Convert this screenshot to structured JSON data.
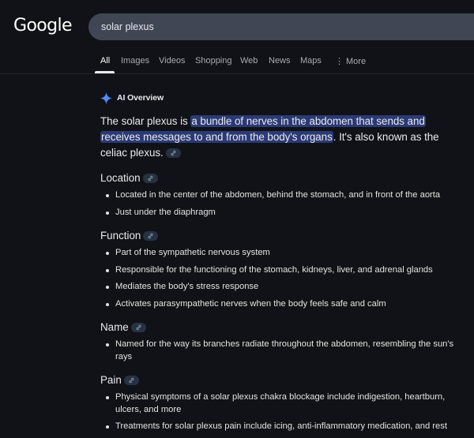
{
  "header": {
    "logo": "Google",
    "search_value": "solar plexus"
  },
  "tabs": [
    {
      "label": "All",
      "active": true
    },
    {
      "label": "Images",
      "active": false
    },
    {
      "label": "Videos",
      "active": false
    },
    {
      "label": "Shopping",
      "active": false
    },
    {
      "label": "Web",
      "active": false
    },
    {
      "label": "News",
      "active": false
    },
    {
      "label": "Maps",
      "active": false
    },
    {
      "label": "More",
      "active": false
    }
  ],
  "ai_overview": {
    "label": "AI Overview",
    "icon": "sparkle-icon",
    "accent_color": "#4c8df6",
    "highlight_color": "#2b3a74",
    "intro_before": "The solar plexus is ",
    "intro_highlight": "a bundle of nerves in the abdomen that sends and receives messages to and from the body's organs",
    "intro_after": ". It's also known as the celiac plexus.",
    "sections": [
      {
        "title": "Location",
        "items": [
          "Located in the center of the abdomen, behind the stomach, and in front of the aorta",
          "Just under the diaphragm"
        ]
      },
      {
        "title": "Function",
        "items": [
          "Part of the sympathetic nervous system",
          "Responsible for the functioning of the stomach, kidneys, liver, and adrenal glands",
          "Mediates the body's stress response",
          "Activates parasympathetic nerves when the body feels safe and calm"
        ]
      },
      {
        "title": "Name",
        "items": [
          "Named for the way its branches radiate throughout the abdomen, resembling the sun's rays"
        ]
      },
      {
        "title": "Pain",
        "items": [
          "Physical symptoms of a solar plexus chakra blockage include indigestion, heartburn, ulcers, and more",
          "Treatments for solar plexus pain include icing, anti-inflammatory medication, and rest"
        ]
      }
    ]
  }
}
